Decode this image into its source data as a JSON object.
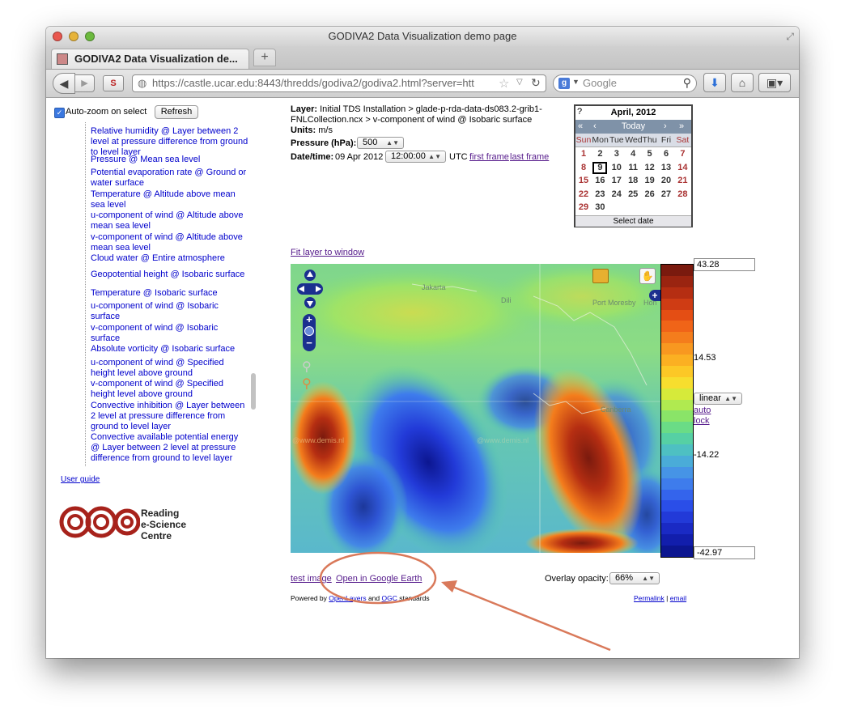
{
  "window": {
    "title": "GODIVA2 Data Visualization demo page"
  },
  "tab": {
    "title": "GODIVA2 Data Visualization de...",
    "new_tab": "+"
  },
  "nav": {
    "back": "◀",
    "forward": "▶",
    "site_icon": "S",
    "url": "https://castle.ucar.edu:8443/thredds/godiva2/godiva2.html?server=htt",
    "search_placeholder": "Google",
    "search_engine_glyph": "g"
  },
  "sidebar": {
    "autozoom_label": "Auto-zoom on select",
    "refresh_label": "Refresh",
    "variables": [
      "Relative humidity @ Layer between 2 level at pressure difference from ground to level layer",
      "Pressure @ Mean sea level",
      "Potential evaporation rate @ Ground or water surface",
      "Temperature @ Altitude above mean sea level",
      "u-component of wind @ Altitude above mean sea level",
      "v-component of wind @ Altitude above mean sea level",
      "Cloud water @ Entire atmosphere",
      "Geopotential height @ Isobaric surface",
      "Temperature @ Isobaric surface",
      "u-component of wind @ Isobaric surface",
      "v-component of wind @ Isobaric surface",
      "Absolute vorticity @ Isobaric surface",
      "u-component of wind @ Specified height level above ground",
      "v-component of wind @ Specified height level above ground",
      "Convective inhibition @ Layer between 2 level at pressure difference from ground to level layer",
      "Convective available potential energy @ Layer between 2 level at pressure difference from ground to level layer"
    ],
    "user_guide": "User guide",
    "logo_text": [
      "Reading",
      "e-Science",
      "Centre"
    ]
  },
  "info": {
    "layer_label": "Layer:",
    "layer_value_1": "Initial TDS Installation > glade-p-rda-data-ds083.2-grib1-",
    "layer_value_2": "FNLCollection.ncx > v-component of wind @ Isobaric surface",
    "units_label": "Units:",
    "units_value": "m/s",
    "pressure_label": "Pressure (hPa):",
    "pressure_value": "500",
    "datetime_label": "Date/time:",
    "date_value": "09 Apr 2012",
    "time_value": "12:00:00",
    "utc": "UTC",
    "first_frame": "first frame",
    "last_frame": "last frame",
    "fit_layer": "Fit layer to window"
  },
  "calendar": {
    "help": "?",
    "month": "April, 2012",
    "prev_year": "«",
    "prev_month": "‹",
    "today": "Today",
    "next_month": "›",
    "next_year": "»",
    "weekdays": [
      "Sun",
      "Mon",
      "Tue",
      "Wed",
      "Thu",
      "Fri",
      "Sat"
    ],
    "days": [
      "1",
      "2",
      "3",
      "4",
      "5",
      "6",
      "7",
      "8",
      "9",
      "10",
      "11",
      "12",
      "13",
      "14",
      "15",
      "16",
      "17",
      "18",
      "19",
      "20",
      "21",
      "22",
      "23",
      "24",
      "25",
      "26",
      "27",
      "28",
      "29",
      "30"
    ],
    "selected_day": "9",
    "footer": "Select date"
  },
  "map": {
    "labels": {
      "jakarta": "Jakarta",
      "dili": "Dili",
      "port_moresby": "Port Moresby",
      "hon": "Hon",
      "canberra": "Canberra"
    },
    "watermark": "@www.demis.nl",
    "overlay_opacity_label": "Overlay opacity:",
    "overlay_opacity_value": "66%"
  },
  "legend": {
    "max": "43.28",
    "upper_mid": "14.53",
    "lower_mid": "-14.22",
    "min": "-42.97",
    "scale": "linear",
    "auto": "auto",
    "lock": "lock",
    "colors": [
      "#7a1a0e",
      "#9a2410",
      "#b52e12",
      "#cf3c14",
      "#e44e14",
      "#f06418",
      "#f47d1c",
      "#f89820",
      "#fbb022",
      "#fcc826",
      "#f7de2e",
      "#d6ea3a",
      "#b0ea50",
      "#8ae468",
      "#6adc86",
      "#56d0a4",
      "#4ec0c2",
      "#4aacd8",
      "#4694e6",
      "#3e7cec",
      "#3464ec",
      "#2a4ee8",
      "#223ad8",
      "#1a2ac4",
      "#121eac",
      "#0c1690"
    ]
  },
  "footer": {
    "test_image": "test image",
    "open_google_earth": "Open in Google Earth",
    "powered_by": "Powered by",
    "openlayers": "OpenLayers",
    "and": "and",
    "ogc": "OGC",
    "standards": "standards",
    "permalink": "Permalink",
    "separator": "|",
    "email": "email"
  },
  "colors": {
    "link": "#0000cc",
    "annotation": "#d9795a"
  }
}
